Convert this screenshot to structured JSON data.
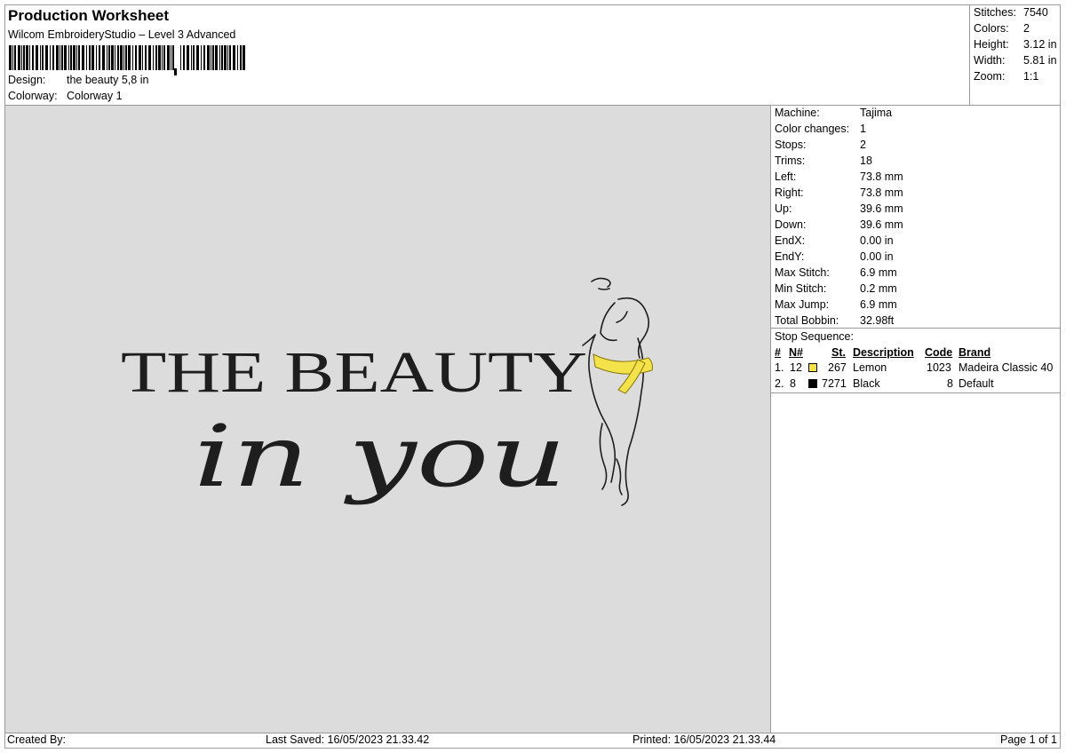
{
  "header": {
    "title": "Production Worksheet",
    "software": "Wilcom EmbroideryStudio – Level 3 Advanced",
    "design_label": "Design:",
    "design_value": "the beauty 5,8 in",
    "colorway_label": "Colorway:",
    "colorway_value": "Colorway 1"
  },
  "summary": [
    {
      "label": "Stitches:",
      "value": "7540"
    },
    {
      "label": "Colors:",
      "value": "2"
    },
    {
      "label": "Height:",
      "value": "3.12 in"
    },
    {
      "label": "Width:",
      "value": "5.81 in"
    },
    {
      "label": "Zoom:",
      "value": "1:1"
    }
  ],
  "design_art": {
    "line1": "THE BEAUTY",
    "line2": "in you",
    "thread_colors": {
      "black": "#1e1e1e",
      "lemon": "#f3e24a"
    },
    "canvas_color": "#dcdcdc"
  },
  "machine_info": [
    {
      "label": "Machine:",
      "value": "Tajima"
    },
    {
      "label": "Color changes:",
      "value": "1"
    },
    {
      "label": "Stops:",
      "value": "2"
    },
    {
      "label": "Trims:",
      "value": "18"
    },
    {
      "label": "Left:",
      "value": "73.8 mm"
    },
    {
      "label": "Right:",
      "value": "73.8 mm"
    },
    {
      "label": "Up:",
      "value": "39.6 mm"
    },
    {
      "label": "Down:",
      "value": "39.6 mm"
    },
    {
      "label": "EndX:",
      "value": "0.00 in"
    },
    {
      "label": "EndY:",
      "value": "0.00 in"
    },
    {
      "label": "Max Stitch:",
      "value": "6.9 mm"
    },
    {
      "label": "Min Stitch:",
      "value": "0.2 mm"
    },
    {
      "label": "Max Jump:",
      "value": "6.9 mm"
    },
    {
      "label": "Total Bobbin:",
      "value": "32.98ft"
    }
  ],
  "stop_sequence": {
    "title": "Stop Sequence:",
    "headers": {
      "index": "#",
      "needle": "N#",
      "stitches": "St.",
      "description": "Description",
      "code": "Code",
      "brand": "Brand"
    },
    "rows": [
      {
        "index": "1.",
        "needle": "12",
        "color": "#f5e34a",
        "stitches": "267",
        "description": "Lemon",
        "code": "1023",
        "brand": "Madeira Classic 40"
      },
      {
        "index": "2.",
        "needle": "8",
        "color": "#000000",
        "stitches": "7271",
        "description": "Black",
        "code": "8",
        "brand": "Default"
      }
    ]
  },
  "footer": {
    "created_by": "Created By:",
    "last_saved": "Last Saved: 16/05/2023 21.33.42",
    "printed": "Printed: 16/05/2023 21.33.44",
    "page": "Page 1 of 1"
  }
}
